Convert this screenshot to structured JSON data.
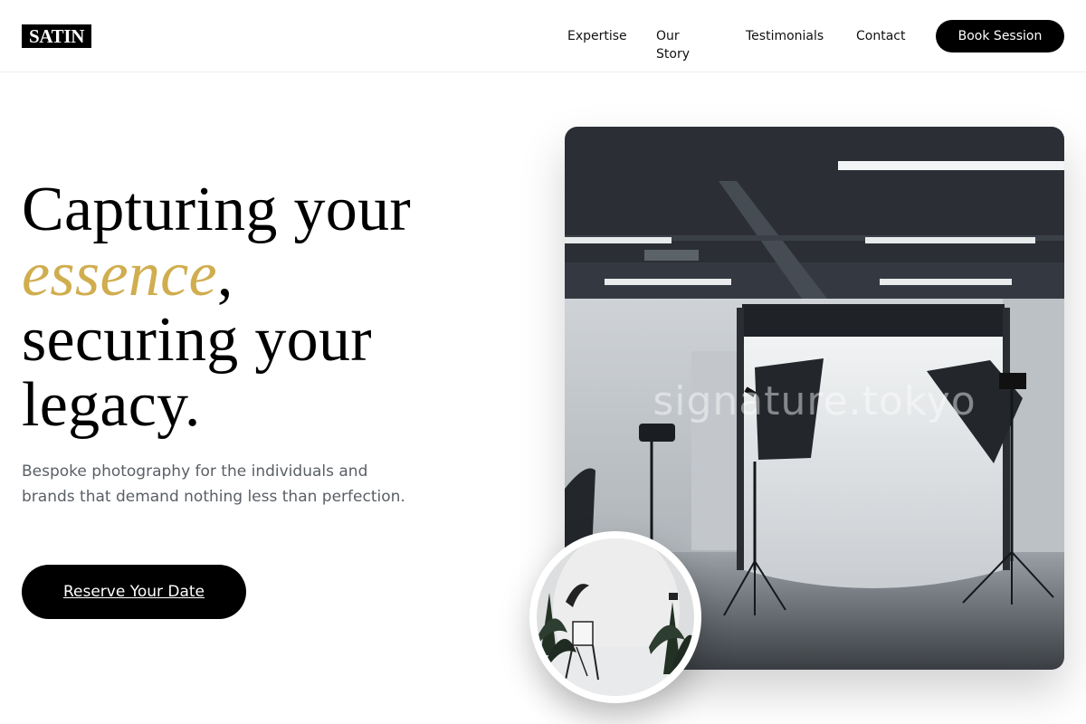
{
  "brand": {
    "logo_text": "SATIN"
  },
  "nav": {
    "items": [
      "Expertise",
      "Our Story",
      "Testimonials",
      "Contact"
    ],
    "cta_label": "Book Session"
  },
  "hero": {
    "headline_part1": "Capturing your",
    "headline_accent": "essence",
    "headline_comma": ",",
    "headline_part2": "securing your",
    "headline_part3": "legacy.",
    "subtitle": "Bespoke photography for the individuals and brands that demand nothing less than perfection.",
    "cta_label": "Reserve Your Date"
  },
  "images": {
    "main_alt": "Photography studio with softbox lights and white backdrop",
    "main_watermark": "signature.tokyo",
    "thumb_alt": "White studio set with plants and a folding chair"
  },
  "colors": {
    "accent": "#d0ad4e",
    "primary": "#000000",
    "muted_text": "#5a5f66"
  }
}
